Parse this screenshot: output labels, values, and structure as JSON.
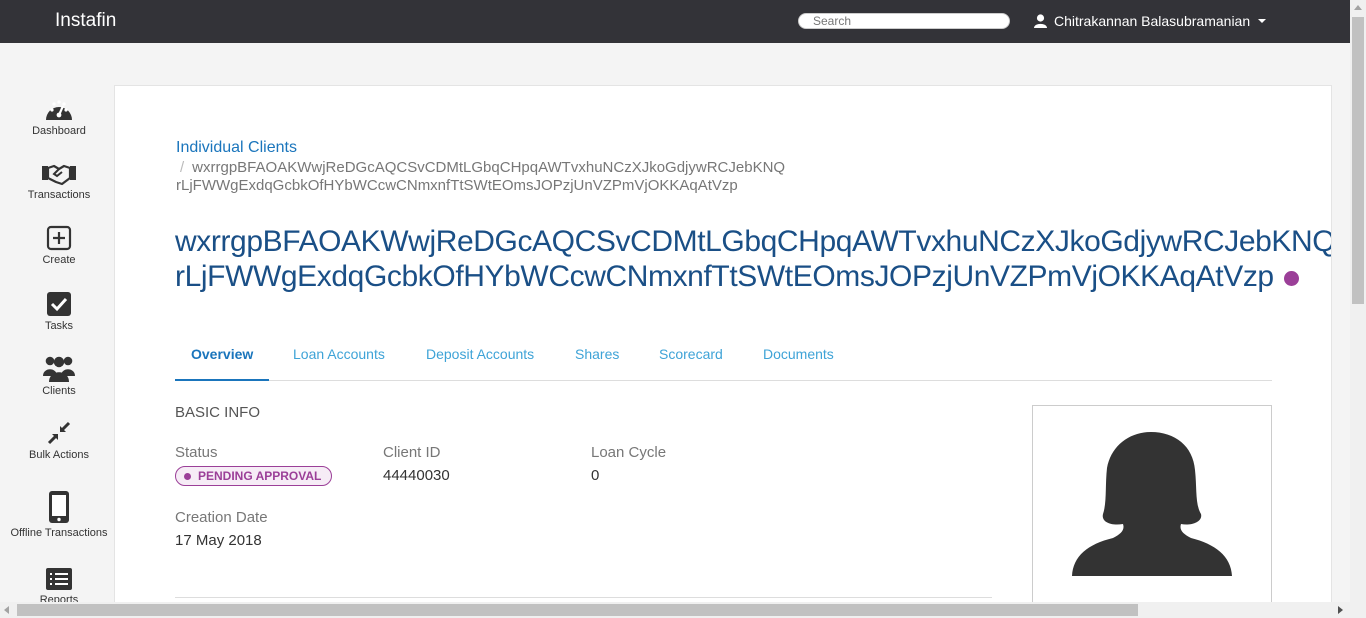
{
  "header": {
    "brand": "Instafin",
    "search_placeholder": "Search",
    "user_name": "Chitrakannan Balasubramanian"
  },
  "sidebar": {
    "items": [
      {
        "label": "Dashboard",
        "icon": "dashboard-gauge-icon"
      },
      {
        "label": "Transactions",
        "icon": "handshake-icon"
      },
      {
        "label": "Create",
        "icon": "plus-square-icon"
      },
      {
        "label": "Tasks",
        "icon": "check-square-icon"
      },
      {
        "label": "Clients",
        "icon": "users-group-icon"
      },
      {
        "label": "Bulk Actions",
        "icon": "compress-arrows-icon"
      },
      {
        "label": "Offline Transactions",
        "icon": "mobile-phone-icon"
      },
      {
        "label": "Reports",
        "icon": "list-report-icon"
      }
    ]
  },
  "breadcrumb": {
    "parent": "Individual Clients",
    "current_line1": "wxrrgpBFAOAKWwjReDGcAQCSvCDMtLGbqCHpqAWTvxhuNCzXJkoGdjywRCJebKNQ",
    "current_line2": "rLjFWWgExdqGcbkOfHYbWCcwCNmxnfTtSWtEOmsJOPzjUnVZPmVjOKKAqAtVzp"
  },
  "client": {
    "name_line1": "wxrrgpBFAOAKWwjReDGcAQCSvCDMtLGbqCHpqAWTvxhuNCzXJkoGdjywRCJebKNQ",
    "name_line2": "rLjFWWgExdqGcbkOfHYbWCcwCNmxnfTtSWtEOmsJOPzjUnVZPmVjOKKAqAtVzp",
    "status_color": "#9b3f98"
  },
  "tabs": [
    {
      "label": "Overview",
      "active": true
    },
    {
      "label": "Loan Accounts"
    },
    {
      "label": "Deposit Accounts"
    },
    {
      "label": "Shares"
    },
    {
      "label": "Scorecard"
    },
    {
      "label": "Documents"
    }
  ],
  "basic_info": {
    "heading": "BASIC INFO",
    "status_label": "Status",
    "status_value": "PENDING APPROVAL",
    "client_id_label": "Client ID",
    "client_id_value": "44440030",
    "loan_cycle_label": "Loan Cycle",
    "loan_cycle_value": "0",
    "creation_date_label": "Creation Date",
    "creation_date_value": "17 May 2018"
  },
  "photo": {
    "icon": "female-avatar-silhouette-icon"
  },
  "colors": {
    "topbar": "#333338",
    "accent": "#1a75bc",
    "status": "#9b3f98"
  }
}
